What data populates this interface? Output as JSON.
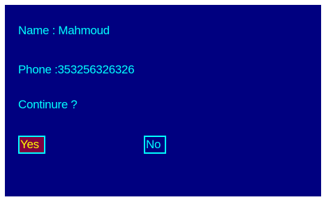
{
  "dialog": {
    "name_line": "Name : Mahmoud",
    "phone_line": "Phone :353256326326",
    "question": "Continure ?",
    "yes_label": "Yes",
    "no_label": "No",
    "selected_button": "Yes"
  },
  "colors": {
    "background": "#000080",
    "text": "#00ffff",
    "selected_button_background": "#800040",
    "selected_button_text": "#ffff00",
    "button_border": "#00ffff"
  }
}
